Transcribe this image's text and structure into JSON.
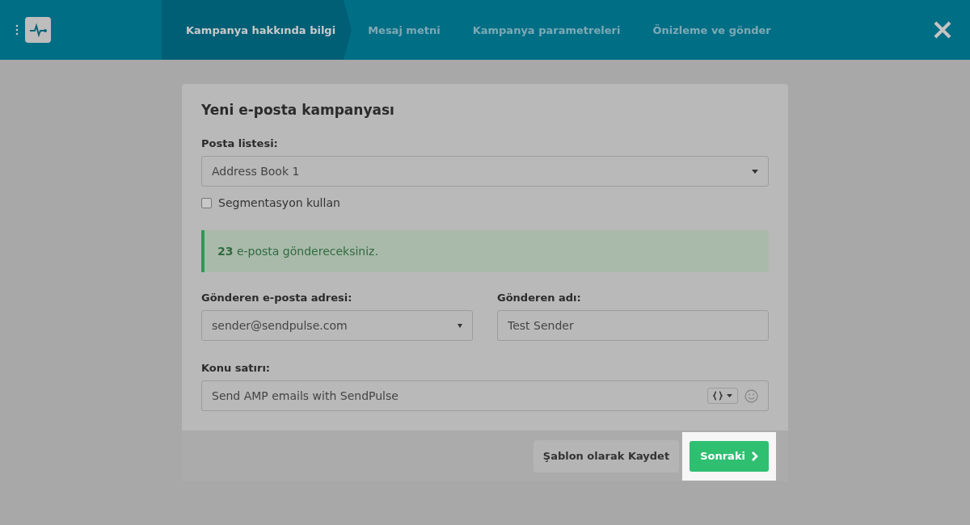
{
  "header": {
    "steps": [
      {
        "label": "Kampanya hakkında bilgi",
        "selected": true
      },
      {
        "label": "Mesaj metni",
        "selected": false
      },
      {
        "label": "Kampanya parametreleri",
        "selected": false
      },
      {
        "label": "Önizleme ve gönder",
        "selected": false
      }
    ]
  },
  "form": {
    "title": "Yeni e-posta kampanyası",
    "mailing_list": {
      "label": "Posta listesi:",
      "value": "Address Book 1"
    },
    "segmentation": {
      "label": "Segmentasyon kullan",
      "checked": false
    },
    "alert": {
      "text": "**23** e-posta göndereceksiniz."
    },
    "sender_email": {
      "label": "Gönderen e-posta adresi:",
      "value": "sender@sendpulse.com"
    },
    "sender_name": {
      "label": "Gönderen adı:",
      "value": "Test Sender"
    },
    "subject": {
      "label": "Konu satırı:",
      "value": "Send AMP emails with SendPulse"
    }
  },
  "buttons": {
    "save": "Şablon olarak Kaydet",
    "next": "Sonraki"
  }
}
